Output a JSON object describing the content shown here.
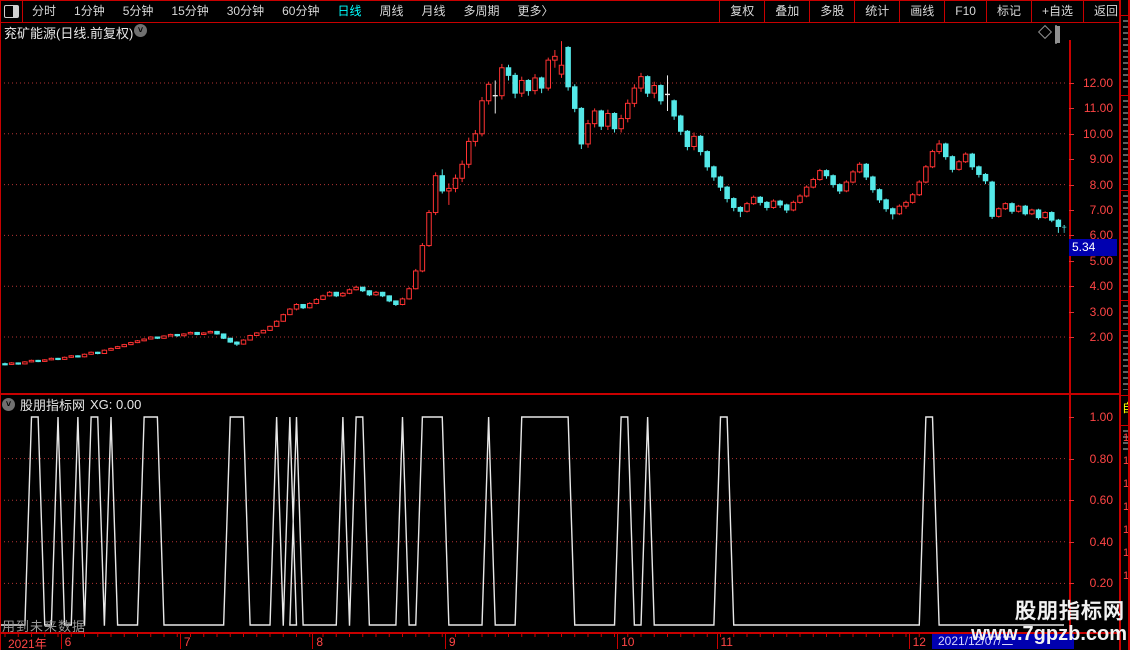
{
  "toolbar": {
    "left_items": [
      "分时",
      "1分钟",
      "5分钟",
      "15分钟",
      "30分钟",
      "60分钟",
      "日线",
      "周线",
      "月线",
      "多周期",
      "更多〉"
    ],
    "active_item": "日线",
    "right_items": [
      "复权",
      "叠加",
      "多股",
      "统计",
      "画线",
      "F10",
      "标记",
      "+自选",
      "返回"
    ]
  },
  "title_bar": {
    "title": "兖矿能源(日线.前复权)"
  },
  "indicator_header": {
    "name": "股朋指标网",
    "value_text": "XG: 0.00"
  },
  "warning_text": "用到未来数据",
  "watermark": {
    "line1": "股朋指标网",
    "line2": "www.7gpzb.com"
  },
  "date_row": {
    "year": "2021年",
    "session_label": "2021/12/07/二"
  },
  "right_strip": {
    "yellow_mark": "自",
    "digits": [
      "1",
      "1",
      "1",
      "1",
      "1",
      "1",
      "1"
    ]
  },
  "colors": {
    "frame": "#c80000",
    "grid": "#b43434",
    "up": "#ff3232",
    "down": "#54e8e8",
    "doji": "#e8e8e8",
    "signal": "#e8e8e8",
    "axis_text": "#ff4545",
    "highlight": "#0000b0"
  },
  "chart_data": {
    "type": "candlestick+signal",
    "title": "兖矿能源(日线.前复权)",
    "last_price": "5.34",
    "last_price_value": 5.34,
    "main": {
      "ylim": [
        0,
        13.7
      ],
      "axis_ticks": [
        12,
        11,
        10,
        9,
        8,
        7,
        6,
        5,
        4,
        3,
        2
      ],
      "grid_prices": [
        12,
        10,
        8,
        6,
        4,
        2
      ],
      "marker_glyph": "†",
      "candles": [
        [
          0.95,
          0.99,
          0.88,
          0.92
        ],
        [
          0.92,
          1.01,
          0.9,
          0.98
        ],
        [
          0.98,
          1.0,
          0.91,
          0.94
        ],
        [
          0.94,
          1.05,
          0.92,
          1.02
        ],
        [
          1.02,
          1.11,
          1.0,
          1.08
        ],
        [
          1.08,
          1.1,
          1.01,
          1.04
        ],
        [
          1.04,
          1.13,
          1.02,
          1.1
        ],
        [
          1.1,
          1.19,
          1.08,
          1.16
        ],
        [
          1.16,
          1.18,
          1.09,
          1.12
        ],
        [
          1.12,
          1.23,
          1.1,
          1.2
        ],
        [
          1.2,
          1.29,
          1.18,
          1.26
        ],
        [
          1.26,
          1.28,
          1.19,
          1.22
        ],
        [
          1.22,
          1.35,
          1.2,
          1.32
        ],
        [
          1.32,
          1.43,
          1.3,
          1.4
        ],
        [
          1.4,
          1.42,
          1.32,
          1.35
        ],
        [
          1.35,
          1.51,
          1.33,
          1.48
        ],
        [
          1.48,
          1.58,
          1.46,
          1.55
        ],
        [
          1.55,
          1.65,
          1.53,
          1.62
        ],
        [
          1.62,
          1.73,
          1.6,
          1.7
        ],
        [
          1.7,
          1.81,
          1.68,
          1.78
        ],
        [
          1.78,
          1.88,
          1.76,
          1.85
        ],
        [
          1.85,
          1.95,
          1.83,
          1.92
        ],
        [
          1.92,
          2.03,
          1.9,
          2.0
        ],
        [
          2.0,
          2.02,
          1.92,
          1.95
        ],
        [
          1.95,
          2.07,
          1.93,
          2.04
        ],
        [
          2.04,
          2.13,
          2.02,
          2.1
        ],
        [
          2.1,
          2.12,
          2.01,
          2.05
        ],
        [
          2.05,
          2.15,
          2.03,
          2.12
        ],
        [
          2.12,
          2.21,
          2.1,
          2.18
        ],
        [
          2.18,
          2.2,
          2.07,
          2.1
        ],
        [
          2.1,
          2.19,
          2.08,
          2.16
        ],
        [
          2.16,
          2.25,
          2.14,
          2.22
        ],
        [
          2.22,
          2.24,
          2.09,
          2.12
        ],
        [
          2.12,
          2.14,
          1.92,
          1.95
        ],
        [
          1.95,
          1.97,
          1.77,
          1.8
        ],
        [
          1.8,
          1.83,
          1.65,
          1.72
        ],
        [
          1.72,
          1.91,
          1.7,
          1.88
        ],
        [
          1.88,
          2.09,
          1.86,
          2.06
        ],
        [
          2.06,
          2.19,
          2.04,
          2.16
        ],
        [
          2.16,
          2.29,
          2.14,
          2.26
        ],
        [
          2.26,
          2.45,
          2.24,
          2.42
        ],
        [
          2.42,
          2.66,
          2.4,
          2.62
        ],
        [
          2.62,
          2.92,
          2.6,
          2.88
        ],
        [
          2.88,
          3.14,
          2.86,
          3.1
        ],
        [
          3.1,
          3.33,
          3.05,
          3.28
        ],
        [
          3.28,
          3.3,
          3.1,
          3.15
        ],
        [
          3.15,
          3.37,
          3.12,
          3.32
        ],
        [
          3.32,
          3.53,
          3.29,
          3.48
        ],
        [
          3.48,
          3.67,
          3.45,
          3.62
        ],
        [
          3.62,
          3.81,
          3.59,
          3.76
        ],
        [
          3.76,
          3.78,
          3.57,
          3.62
        ],
        [
          3.62,
          3.77,
          3.58,
          3.72
        ],
        [
          3.72,
          3.91,
          3.69,
          3.86
        ],
        [
          3.86,
          4.02,
          3.83,
          3.96
        ],
        [
          3.96,
          3.98,
          3.77,
          3.82
        ],
        [
          3.82,
          3.84,
          3.61,
          3.66
        ],
        [
          3.66,
          3.81,
          3.62,
          3.76
        ],
        [
          3.76,
          3.78,
          3.57,
          3.62
        ],
        [
          3.62,
          3.64,
          3.37,
          3.42
        ],
        [
          3.42,
          3.44,
          3.22,
          3.28
        ],
        [
          3.28,
          3.55,
          3.25,
          3.5
        ],
        [
          3.5,
          3.96,
          3.47,
          3.9
        ],
        [
          3.9,
          4.68,
          3.87,
          4.6
        ],
        [
          4.6,
          5.7,
          4.55,
          5.6
        ],
        [
          5.6,
          7.0,
          5.55,
          6.9
        ],
        [
          6.9,
          8.48,
          6.8,
          8.35
        ],
        [
          8.35,
          8.6,
          7.65,
          7.75
        ],
        [
          7.75,
          8.05,
          7.2,
          7.85
        ],
        [
          7.85,
          8.4,
          7.7,
          8.25
        ],
        [
          8.25,
          8.95,
          8.1,
          8.8
        ],
        [
          8.8,
          9.85,
          8.65,
          9.7
        ],
        [
          9.7,
          10.15,
          9.5,
          10.0
        ],
        [
          10.0,
          11.45,
          9.9,
          11.3
        ],
        [
          11.3,
          12.05,
          11.15,
          11.95
        ],
        [
          11.5,
          12.1,
          10.8,
          11.5
        ],
        [
          11.5,
          12.75,
          11.35,
          12.6
        ],
        [
          12.6,
          12.72,
          12.1,
          12.3
        ],
        [
          12.3,
          12.4,
          11.4,
          11.6
        ],
        [
          11.6,
          12.25,
          11.45,
          12.1
        ],
        [
          12.1,
          12.15,
          11.5,
          11.7
        ],
        [
          11.7,
          12.35,
          11.55,
          12.2
        ],
        [
          12.2,
          12.25,
          11.6,
          11.8
        ],
        [
          11.8,
          13.0,
          11.7,
          12.9
        ],
        [
          12.9,
          13.3,
          12.6,
          13.05
        ],
        [
          12.35,
          13.65,
          12.2,
          12.7
        ],
        [
          13.4,
          13.45,
          11.7,
          11.85
        ],
        [
          11.85,
          11.95,
          10.85,
          11.0
        ],
        [
          11.0,
          11.05,
          9.4,
          9.6
        ],
        [
          9.6,
          10.55,
          9.45,
          10.4
        ],
        [
          10.4,
          11.0,
          10.25,
          10.9
        ],
        [
          10.9,
          10.95,
          10.15,
          10.3
        ],
        [
          10.3,
          10.95,
          10.15,
          10.8
        ],
        [
          10.8,
          10.85,
          10.05,
          10.2
        ],
        [
          10.2,
          10.75,
          10.05,
          10.6
        ],
        [
          10.6,
          11.35,
          10.45,
          11.2
        ],
        [
          11.2,
          11.95,
          11.05,
          11.8
        ],
        [
          11.8,
          12.4,
          11.65,
          12.25
        ],
        [
          12.25,
          12.3,
          11.45,
          11.6
        ],
        [
          11.6,
          12.05,
          11.4,
          11.9
        ],
        [
          11.9,
          11.95,
          11.15,
          11.3
        ],
        [
          11.55,
          12.3,
          10.9,
          11.55
        ],
        [
          11.3,
          11.35,
          10.55,
          10.7
        ],
        [
          10.7,
          10.75,
          9.95,
          10.1
        ],
        [
          10.1,
          10.15,
          9.35,
          9.5
        ],
        [
          9.5,
          10.05,
          9.35,
          9.9
        ],
        [
          9.9,
          9.95,
          9.15,
          9.3
        ],
        [
          9.3,
          9.35,
          8.55,
          8.7
        ],
        [
          8.7,
          8.75,
          8.15,
          8.3
        ],
        [
          8.3,
          8.35,
          7.75,
          7.9
        ],
        [
          7.9,
          7.95,
          7.3,
          7.45
        ],
        [
          7.45,
          7.5,
          6.95,
          7.1
        ],
        [
          7.1,
          7.15,
          6.72,
          6.95
        ],
        [
          6.95,
          7.32,
          6.9,
          7.25
        ],
        [
          7.25,
          7.57,
          7.2,
          7.5
        ],
        [
          7.5,
          7.55,
          7.18,
          7.3
        ],
        [
          7.3,
          7.35,
          6.98,
          7.1
        ],
        [
          7.1,
          7.42,
          7.05,
          7.35
        ],
        [
          7.35,
          7.4,
          7.08,
          7.2
        ],
        [
          7.2,
          7.25,
          6.88,
          7.0
        ],
        [
          7.0,
          7.37,
          6.95,
          7.3
        ],
        [
          7.3,
          7.62,
          7.25,
          7.55
        ],
        [
          7.55,
          7.97,
          7.5,
          7.9
        ],
        [
          7.9,
          8.27,
          7.85,
          8.2
        ],
        [
          8.2,
          8.62,
          8.15,
          8.55
        ],
        [
          8.55,
          8.6,
          8.23,
          8.35
        ],
        [
          8.35,
          8.4,
          7.88,
          8.0
        ],
        [
          8.0,
          8.05,
          7.63,
          7.75
        ],
        [
          7.75,
          8.17,
          7.7,
          8.1
        ],
        [
          8.1,
          8.57,
          8.05,
          8.5
        ],
        [
          8.5,
          8.88,
          8.45,
          8.8
        ],
        [
          8.8,
          8.85,
          8.18,
          8.3
        ],
        [
          8.3,
          8.35,
          7.68,
          7.8
        ],
        [
          7.8,
          7.85,
          7.28,
          7.4
        ],
        [
          7.4,
          7.45,
          6.93,
          7.05
        ],
        [
          7.05,
          7.1,
          6.63,
          6.85
        ],
        [
          6.85,
          7.22,
          6.8,
          7.15
        ],
        [
          7.15,
          7.37,
          7.05,
          7.3
        ],
        [
          7.3,
          7.67,
          7.25,
          7.6
        ],
        [
          7.6,
          8.17,
          7.55,
          8.1
        ],
        [
          8.1,
          8.77,
          8.05,
          8.7
        ],
        [
          8.7,
          9.37,
          8.65,
          9.3
        ],
        [
          9.3,
          9.75,
          9.2,
          9.6
        ],
        [
          9.6,
          9.65,
          8.98,
          9.1
        ],
        [
          9.1,
          9.15,
          8.48,
          8.6
        ],
        [
          8.6,
          8.97,
          8.55,
          8.9
        ],
        [
          8.9,
          9.27,
          8.85,
          9.2
        ],
        [
          9.2,
          9.25,
          8.58,
          8.7
        ],
        [
          8.7,
          8.75,
          8.28,
          8.4
        ],
        [
          8.4,
          8.45,
          8.02,
          8.15
        ],
        [
          8.1,
          8.15,
          6.65,
          6.75
        ],
        [
          6.75,
          7.1,
          6.7,
          7.05
        ],
        [
          7.05,
          7.3,
          7.0,
          7.25
        ],
        [
          7.25,
          7.3,
          6.85,
          6.95
        ],
        [
          6.95,
          7.2,
          6.9,
          7.15
        ],
        [
          7.15,
          7.2,
          6.78,
          6.85
        ],
        [
          6.85,
          7.05,
          6.8,
          7.0
        ],
        [
          7.0,
          7.05,
          6.62,
          6.7
        ],
        [
          6.7,
          6.95,
          6.65,
          6.9
        ],
        [
          6.9,
          6.95,
          6.52,
          6.6
        ],
        [
          6.6,
          6.65,
          6.1,
          6.35
        ]
      ]
    },
    "months": [
      {
        "label": "6",
        "index": 9
      },
      {
        "label": "7",
        "index": 27
      },
      {
        "label": "8",
        "index": 47
      },
      {
        "label": "9",
        "index": 67
      },
      {
        "label": "10",
        "index": 93
      },
      {
        "label": "11",
        "index": 108
      },
      {
        "label": "12",
        "index": 137
      }
    ],
    "indicator": {
      "name": "股朋指标网",
      "series_label": "XG",
      "series_value": 0.0,
      "ylim": [
        0,
        1
      ],
      "axis_ticks": [
        1.0,
        0.8,
        0.6,
        0.4,
        0.2
      ],
      "grid_values": [
        0.8,
        0.6,
        0.4,
        0.2
      ],
      "pulses": [
        [
          4,
          5
        ],
        [
          8,
          8
        ],
        [
          11,
          11
        ],
        [
          13,
          14
        ],
        [
          16,
          16
        ],
        [
          21,
          23
        ],
        [
          34,
          36
        ],
        [
          41,
          41
        ],
        [
          43,
          43
        ],
        [
          44,
          44
        ],
        [
          51,
          51
        ],
        [
          53,
          54
        ],
        [
          60,
          60
        ],
        [
          63,
          66
        ],
        [
          73,
          73
        ],
        [
          78,
          85
        ],
        [
          93,
          94
        ],
        [
          97,
          97
        ],
        [
          108,
          109
        ],
        [
          139,
          140
        ]
      ]
    }
  }
}
